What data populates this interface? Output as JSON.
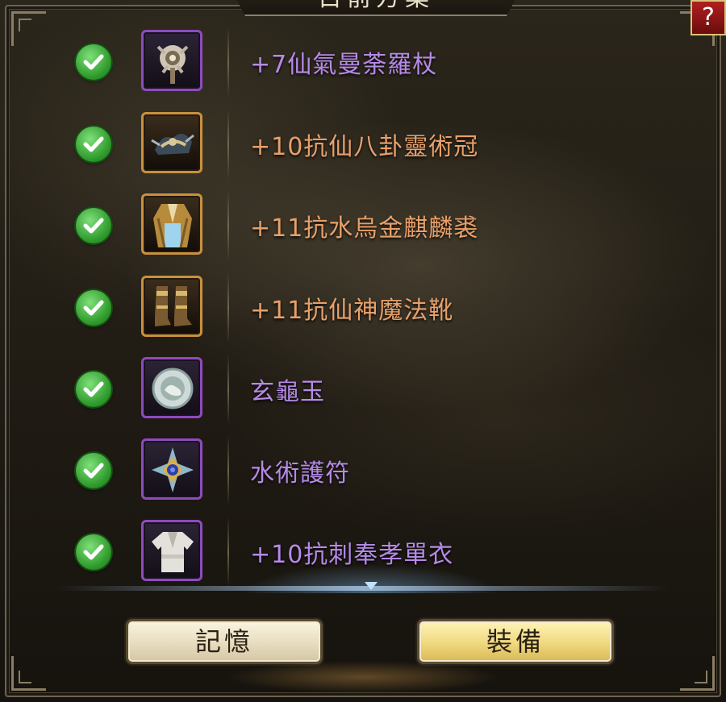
{
  "header": {
    "title": "目前方案",
    "help_label": "?"
  },
  "colors": {
    "purple": "#b68ae8",
    "orange": "#e8a06a"
  },
  "items": [
    {
      "name": "+7仙氣曼荼羅杖",
      "rarity": "purple",
      "icon": "staff-icon",
      "checked": true
    },
    {
      "name": "+10抗仙八卦靈術冠",
      "rarity": "gold",
      "icon": "crown-icon",
      "checked": true
    },
    {
      "name": "+11抗水烏金麒麟裘",
      "rarity": "gold",
      "icon": "robe-icon",
      "checked": true
    },
    {
      "name": "+11抗仙神魔法靴",
      "rarity": "gold",
      "icon": "boots-icon",
      "checked": true
    },
    {
      "name": "玄龜玉",
      "rarity": "purple",
      "icon": "jade-disc-icon",
      "checked": true
    },
    {
      "name": "水術護符",
      "rarity": "purple",
      "icon": "amulet-icon",
      "checked": true
    },
    {
      "name": "+10抗刺奉孝單衣",
      "rarity": "purple",
      "icon": "shirt-icon",
      "checked": true
    }
  ],
  "buttons": {
    "memory_label": "記憶",
    "equip_label": "裝備"
  }
}
